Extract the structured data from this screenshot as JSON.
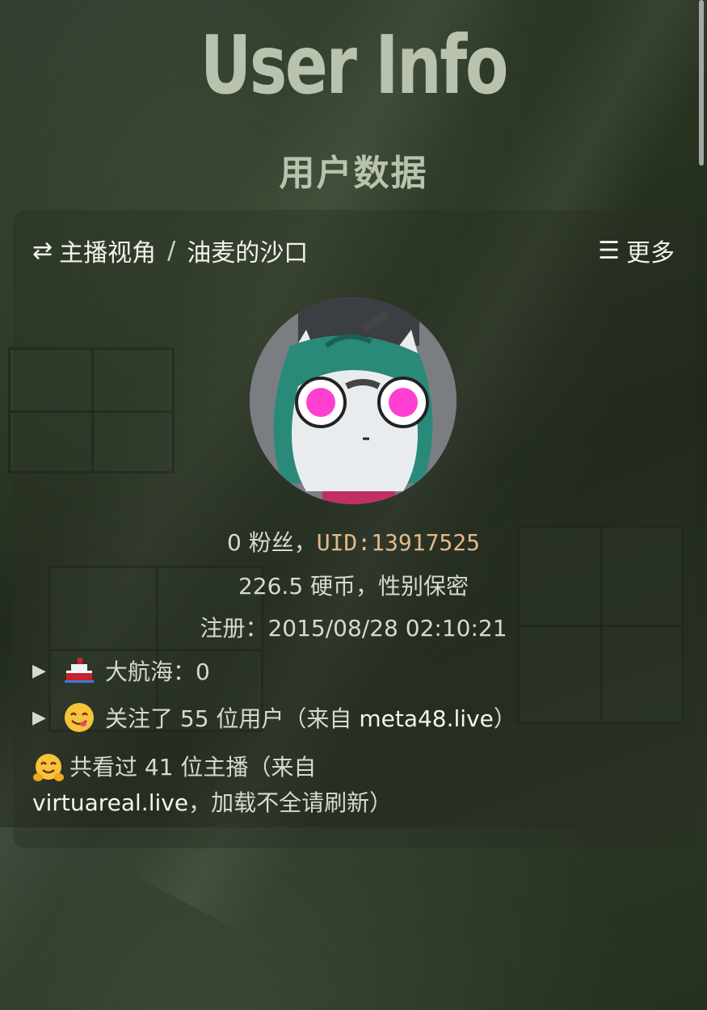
{
  "page": {
    "title": "User Info",
    "subtitle": "用户数据"
  },
  "header": {
    "switch_icon": "⇄",
    "perspective_label": "主播视角",
    "separator": "/",
    "room_name": "油麦的沙口",
    "menu_icon": "☰",
    "more_label": "更多"
  },
  "profile": {
    "followers_text": "0 粉丝，",
    "uid_text": "UID:13917525",
    "coins_gender_text": "226.5 硬币，性别保密",
    "register_text": "注册：2015/08/28 02:10:21"
  },
  "details": {
    "guard": {
      "label": "大航海：0",
      "icon": "ship-icon"
    },
    "following": {
      "prefix": "关注了 55 位用户（来自 ",
      "source": "meta48.live",
      "suffix": "）",
      "icon": "yum-face-icon"
    },
    "watched": {
      "prefix": "共看过 41 位主播（来自 ",
      "source": "virtuareal.live",
      "suffix": "，加载不全请刷新）",
      "icon": "hug-face-icon"
    }
  },
  "colors": {
    "title": "#b8c2ad",
    "uid": "#e4b98a",
    "avatar_eye": "#ff3fd1",
    "avatar_hood": "#2a8a7a"
  }
}
